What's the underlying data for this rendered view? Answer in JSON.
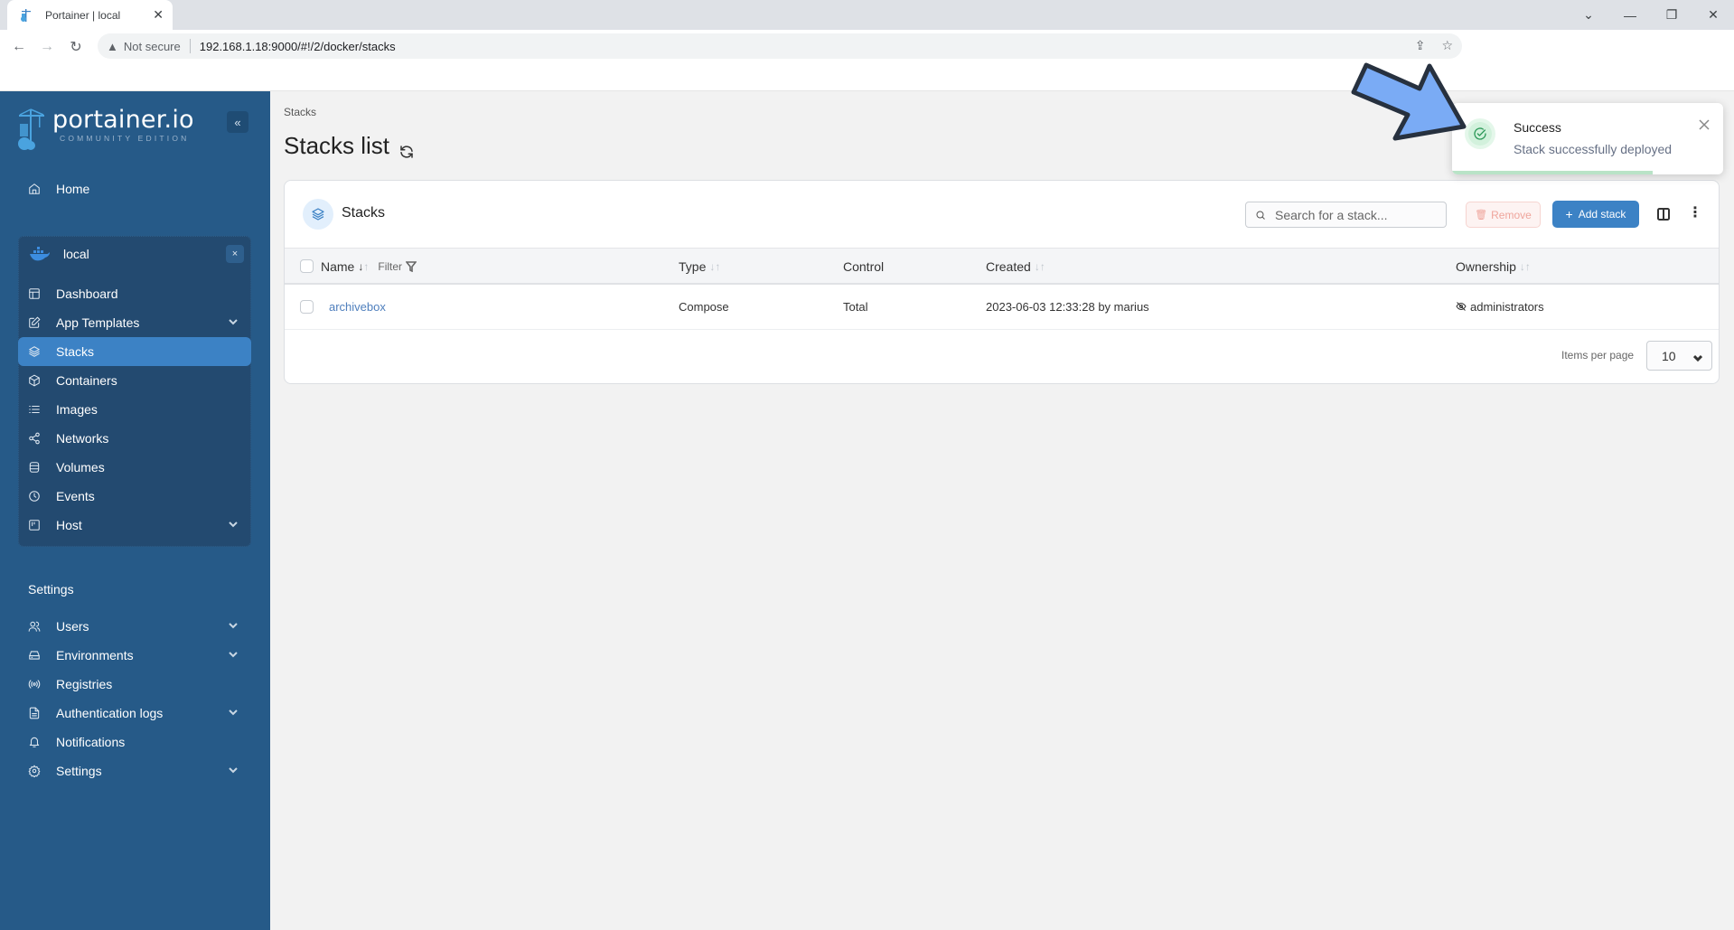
{
  "browser": {
    "tab_title": "Portainer | local",
    "security_label": "Not secure",
    "url": "192.168.1.18:9000/#!/2/docker/stacks"
  },
  "sidebar": {
    "logo_text": "portainer.io",
    "logo_subtitle": "COMMUNITY EDITION",
    "collapse_label": "«",
    "home": {
      "label": "Home",
      "icon": "home-icon"
    },
    "environment": {
      "name": "local",
      "icon": "docker-whale-icon",
      "close_label": "×",
      "items": [
        {
          "label": "Dashboard",
          "icon": "dashboard-icon",
          "expandable": false,
          "active": false
        },
        {
          "label": "App Templates",
          "icon": "edit-icon",
          "expandable": true,
          "active": false
        },
        {
          "label": "Stacks",
          "icon": "layers-icon",
          "expandable": false,
          "active": true
        },
        {
          "label": "Containers",
          "icon": "box-icon",
          "expandable": false,
          "active": false
        },
        {
          "label": "Images",
          "icon": "list-icon",
          "expandable": false,
          "active": false
        },
        {
          "label": "Networks",
          "icon": "share-icon",
          "expandable": false,
          "active": false
        },
        {
          "label": "Volumes",
          "icon": "database-icon",
          "expandable": false,
          "active": false
        },
        {
          "label": "Events",
          "icon": "clock-icon",
          "expandable": false,
          "active": false
        },
        {
          "label": "Host",
          "icon": "server-icon",
          "expandable": true,
          "active": false
        }
      ]
    },
    "settings_section_label": "Settings",
    "settings_items": [
      {
        "label": "Users",
        "icon": "users-icon",
        "expandable": true
      },
      {
        "label": "Environments",
        "icon": "hard-drive-icon",
        "expandable": true
      },
      {
        "label": "Registries",
        "icon": "radio-icon",
        "expandable": false
      },
      {
        "label": "Authentication logs",
        "icon": "file-text-icon",
        "expandable": true
      },
      {
        "label": "Notifications",
        "icon": "bell-icon",
        "expandable": false
      },
      {
        "label": "Settings",
        "icon": "gear-icon",
        "expandable": true
      }
    ]
  },
  "main": {
    "breadcrumb": "Stacks",
    "title": "Stacks list",
    "card": {
      "title": "Stacks",
      "search_placeholder": "Search for a stack...",
      "search_value": "",
      "remove_label": "Remove",
      "add_label": "Add stack",
      "columns": [
        {
          "label": "Name",
          "sortable": true,
          "sorted": "desc",
          "filter_label": "Filter"
        },
        {
          "label": "Type",
          "sortable": true
        },
        {
          "label": "Control",
          "sortable": false
        },
        {
          "label": "Created",
          "sortable": true
        },
        {
          "label": "Ownership",
          "sortable": true
        }
      ],
      "rows": [
        {
          "name": "archivebox",
          "type": "Compose",
          "control": "Total",
          "created": "2023-06-03 12:33:28 by marius",
          "ownership": "administrators"
        }
      ],
      "items_per_page_label": "Items per page",
      "items_per_page_value": "10"
    }
  },
  "toast": {
    "title": "Success",
    "message": "Stack successfully deployed",
    "status_color": "#2f9a5a",
    "progress_percent": 74
  },
  "colors": {
    "sidebar_bg": "#265a88",
    "sidebar_env_bg": "#234a70",
    "accent": "#3c82c5",
    "link": "#4f7fbd",
    "annotation_arrow": "#7aabf5"
  }
}
